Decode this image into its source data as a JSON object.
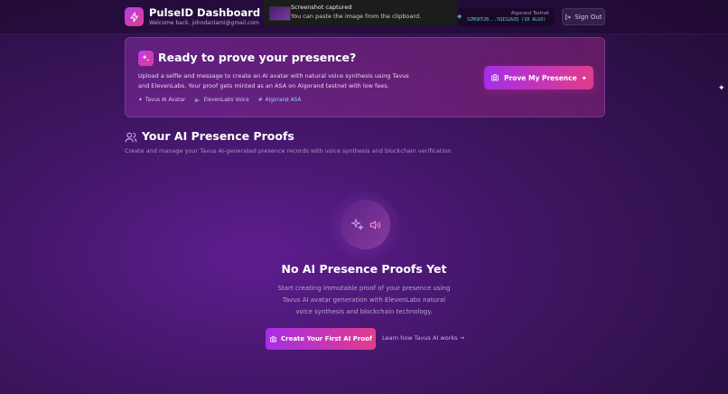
{
  "header": {
    "title": "PulseID Dashboard",
    "subtitle": "Welcome back, johndanlami@gmail.com",
    "wallet": {
      "network": "Algorand Testnet",
      "address": "SZMSRT2B...5QIS2AZQ (10 ALGO)"
    },
    "signout_label": "Sign Out"
  },
  "toast": {
    "title": "Screenshot captured",
    "message": "You can paste the image from the clipboard."
  },
  "hero": {
    "title": "Ready to prove your presence?",
    "description": "Upload a selfie and message to create an AI avatar with natural voice synthesis using Tavus and ElevenLabs. Your proof gets minted as an ASA on Algorand testnet with low fees.",
    "tags": [
      "Tavus AI Avatar",
      "ElevenLabs Voice",
      "Algorand ASA"
    ],
    "button_label": "Prove My Presence"
  },
  "section": {
    "title": "Your AI Presence Proofs",
    "subtitle": "Create and manage your Tavus AI-generated presence records with voice synthesis and blockchain verification"
  },
  "empty_state": {
    "title": "No AI Presence Proofs Yet",
    "description": "Start creating immutable proof of your presence using Tavus AI avatar generation with ElevenLabs natural voice synthesis and blockchain technology.",
    "create_label": "Create Your First AI Proof",
    "learn_label": "Learn how Tavus AI works →"
  },
  "colors": {
    "accent_start": "#a52ee6",
    "accent_end": "#e23c8c",
    "wallet_green": "#5ed3a6"
  }
}
